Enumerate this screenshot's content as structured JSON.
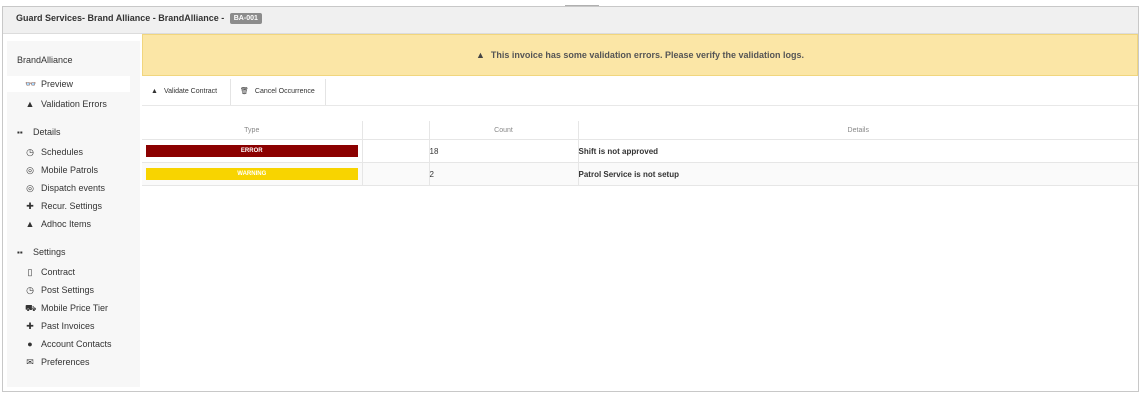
{
  "window": {
    "title": "Guard Services- Brand Alliance - BrandAlliance -",
    "code_badge": "BA-001"
  },
  "sidebar": {
    "brand": "BrandAlliance",
    "top_items": [
      {
        "label": "Preview",
        "icon": "glasses-icon",
        "glyph": "👓"
      },
      {
        "label": "Validation Errors",
        "icon": "warning-icon",
        "glyph": "▲"
      }
    ],
    "details": {
      "title": "Details",
      "icon_glyph": "▪▪",
      "items": [
        {
          "label": "Schedules",
          "icon": "clock-icon",
          "glyph": "◷"
        },
        {
          "label": "Mobile Patrols",
          "icon": "target-icon",
          "glyph": "◎"
        },
        {
          "label": "Dispatch events",
          "icon": "target-icon",
          "glyph": "◎"
        },
        {
          "label": "Recur. Settings",
          "icon": "plus-icon",
          "glyph": "✚"
        },
        {
          "label": "Adhoc Items",
          "icon": "warning-icon",
          "glyph": "▲"
        }
      ]
    },
    "settings": {
      "title": "Settings",
      "icon_glyph": "▪▪",
      "items": [
        {
          "label": "Contract",
          "icon": "document-icon",
          "glyph": "▯"
        },
        {
          "label": "Post Settings",
          "icon": "clock-icon",
          "glyph": "◷"
        },
        {
          "label": "Mobile Price Tier",
          "icon": "car-icon",
          "glyph": "⛟"
        },
        {
          "label": "Past Invoices",
          "icon": "plus-icon",
          "glyph": "✚"
        },
        {
          "label": "Account Contacts",
          "icon": "user-icon",
          "glyph": "●"
        },
        {
          "label": "Preferences",
          "icon": "envelope-icon",
          "glyph": "✉"
        }
      ]
    }
  },
  "alert": {
    "icon_glyph": "▲",
    "message": "This invoice has some validation errors. Please verify the validation logs."
  },
  "toolbar": {
    "validate_label": "Validate Contract",
    "validate_glyph": "▲",
    "cancel_label": "Cancel Occurrence",
    "cancel_glyph": "🗑"
  },
  "grid": {
    "headers": [
      "Type",
      "",
      "Count",
      "Details"
    ],
    "rows": [
      {
        "type": "ERROR",
        "count": "18",
        "details": "Shift is not approved"
      },
      {
        "type": "WARNING",
        "count": "2",
        "details": "Patrol Service is not setup"
      }
    ]
  },
  "colors": {
    "error": "#8b0000",
    "warning": "#f8d400",
    "alert_bg": "#fbe6a6"
  }
}
